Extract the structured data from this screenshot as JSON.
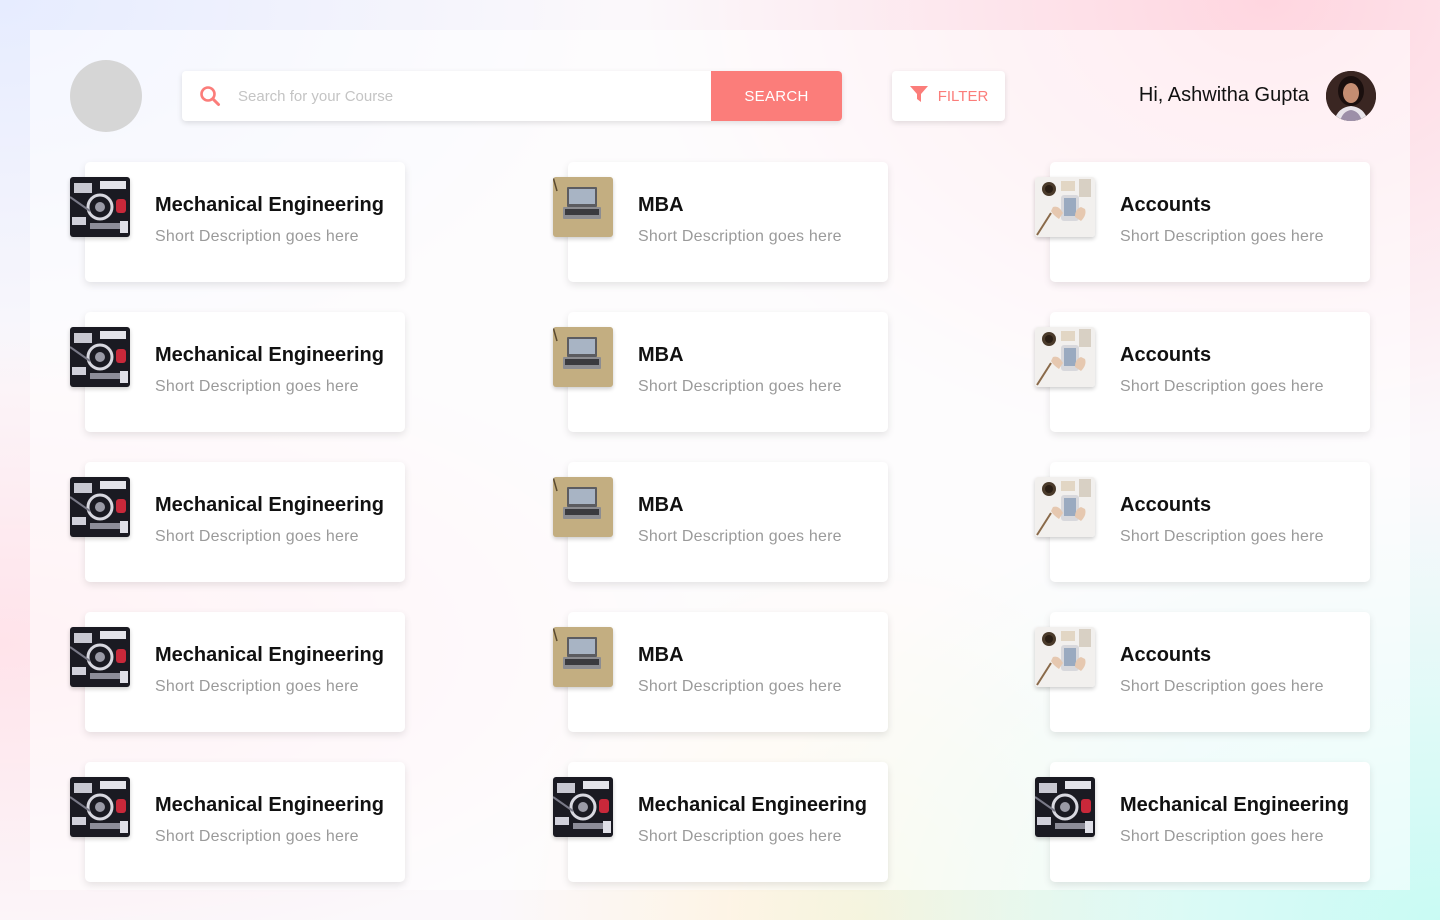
{
  "header": {
    "search_placeholder": "Search for your Course",
    "search_button": "SEARCH",
    "filter_button": "FILTER",
    "greeting": "Hi, Ashwitha Gupta"
  },
  "colors": {
    "accent": "#fb7d7a"
  },
  "courses": [
    {
      "title": "Mechanical Engineering",
      "description": "Short Description goes here",
      "thumb": "engine"
    },
    {
      "title": "MBA",
      "description": "Short Description goes here",
      "thumb": "laptop"
    },
    {
      "title": "Accounts",
      "description": "Short Description goes here",
      "thumb": "desk"
    },
    {
      "title": "Mechanical Engineering",
      "description": "Short Description goes here",
      "thumb": "engine"
    },
    {
      "title": "MBA",
      "description": "Short Description goes here",
      "thumb": "laptop"
    },
    {
      "title": "Accounts",
      "description": "Short Description goes here",
      "thumb": "desk"
    },
    {
      "title": "Mechanical Engineering",
      "description": "Short Description goes here",
      "thumb": "engine"
    },
    {
      "title": "MBA",
      "description": "Short Description goes here",
      "thumb": "laptop"
    },
    {
      "title": "Accounts",
      "description": "Short Description goes here",
      "thumb": "desk"
    },
    {
      "title": "Mechanical Engineering",
      "description": "Short Description goes here",
      "thumb": "engine"
    },
    {
      "title": "MBA",
      "description": "Short Description goes here",
      "thumb": "laptop"
    },
    {
      "title": "Accounts",
      "description": "Short Description goes here",
      "thumb": "desk"
    },
    {
      "title": "Mechanical Engineering",
      "description": "Short Description goes here",
      "thumb": "engine"
    },
    {
      "title": "Mechanical Engineering",
      "description": "Short Description goes here",
      "thumb": "engine"
    },
    {
      "title": "Mechanical Engineering",
      "description": "Short Description goes here",
      "thumb": "engine"
    }
  ]
}
